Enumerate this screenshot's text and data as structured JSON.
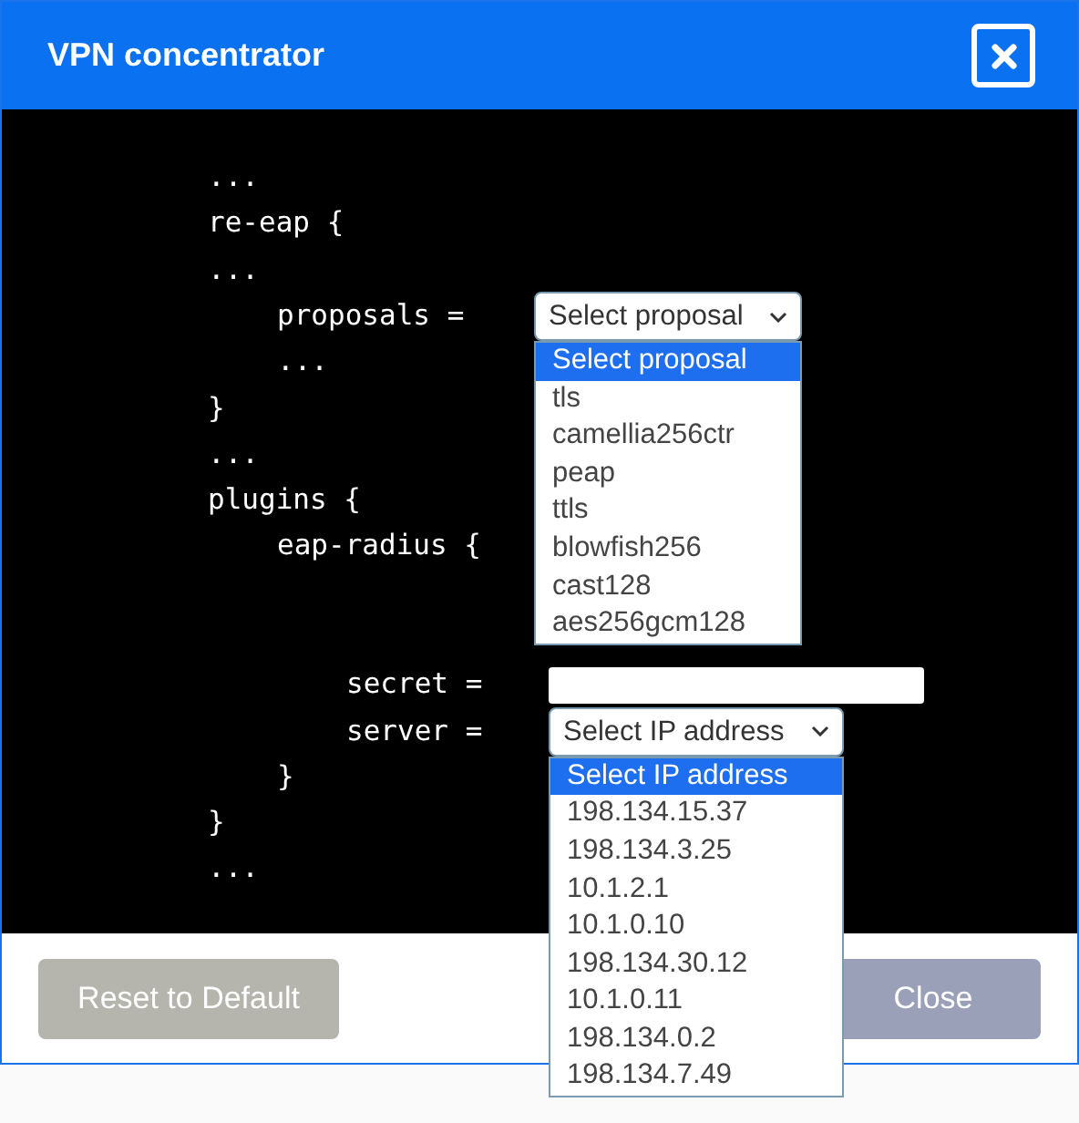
{
  "dialog": {
    "title": "VPN concentrator"
  },
  "code": [
    {
      "kind": "text",
      "text": "..."
    },
    {
      "kind": "text",
      "text": "re-eap {"
    },
    {
      "kind": "text",
      "text": "..."
    },
    {
      "kind": "group",
      "children": [
        {
          "kind": "select",
          "label": "proposals =",
          "value": "Select proposal",
          "expanded": true,
          "options": [
            {
              "label": "Select proposal",
              "selected": true
            },
            {
              "label": "tls",
              "selected": false
            },
            {
              "label": "camellia256ctr",
              "selected": false
            },
            {
              "label": "peap",
              "selected": false
            },
            {
              "label": "ttls",
              "selected": false
            },
            {
              "label": "blowfish256",
              "selected": false
            },
            {
              "label": "cast128",
              "selected": false
            },
            {
              "label": "aes256gcm128",
              "selected": false
            }
          ]
        },
        {
          "kind": "text",
          "text": "..."
        }
      ]
    },
    {
      "kind": "text",
      "text": "}"
    },
    {
      "kind": "text",
      "text": "..."
    },
    {
      "kind": "text",
      "text": "plugins {"
    },
    {
      "kind": "group",
      "children": [
        {
          "kind": "text",
          "text": "eap-radius {"
        },
        {
          "kind": "blank"
        },
        {
          "kind": "blank"
        },
        {
          "kind": "group",
          "children": [
            {
              "kind": "input",
              "label": "secret ="
            },
            {
              "kind": "select",
              "label": "server =",
              "value": "Select IP address",
              "expanded": true,
              "options": [
                {
                  "label": "Select IP address",
                  "selected": true
                },
                {
                  "label": "198.134.15.37",
                  "selected": false
                },
                {
                  "label": "198.134.3.25",
                  "selected": false
                },
                {
                  "label": "10.1.2.1",
                  "selected": false
                },
                {
                  "label": "10.1.0.10",
                  "selected": false
                },
                {
                  "label": "198.134.30.12",
                  "selected": false
                },
                {
                  "label": "10.1.0.11",
                  "selected": false
                },
                {
                  "label": "198.134.0.2",
                  "selected": false
                },
                {
                  "label": "198.134.7.49",
                  "selected": false
                }
              ]
            }
          ]
        },
        {
          "kind": "text",
          "text": "}"
        }
      ]
    },
    {
      "kind": "text",
      "text": "}"
    },
    {
      "kind": "text",
      "text": "..."
    }
  ],
  "buttons": [
    {
      "label": "Reset to Default",
      "kind": "reset"
    },
    {
      "label": "Close",
      "kind": "close"
    }
  ]
}
